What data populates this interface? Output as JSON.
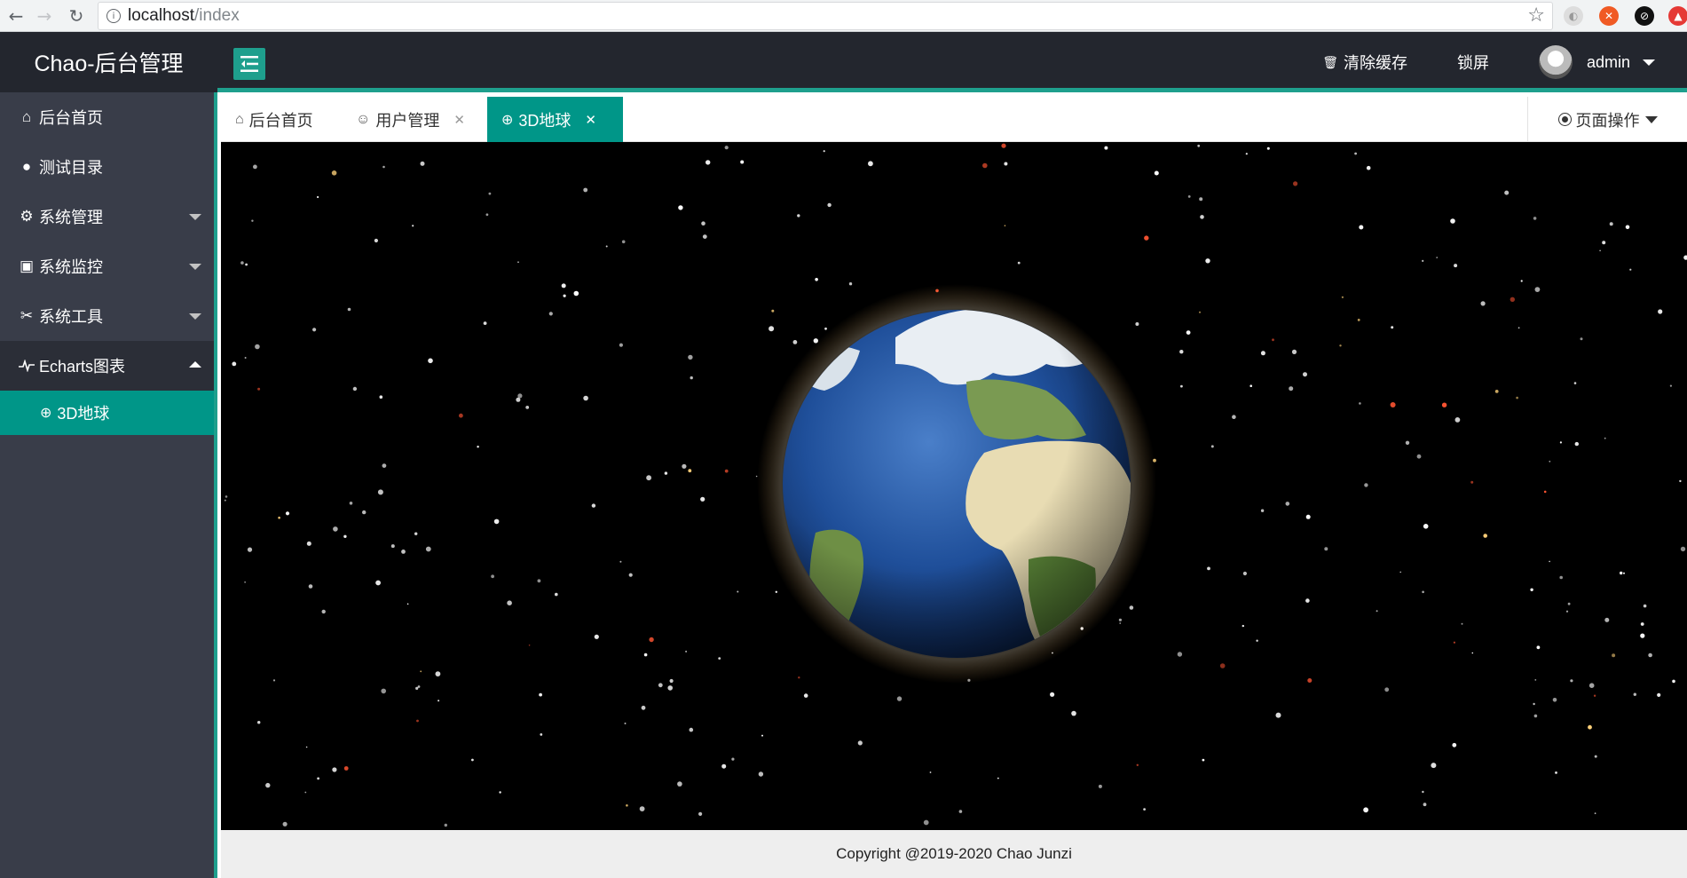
{
  "browser": {
    "back_icon": "arrow-left-icon",
    "forward_icon": "arrow-right-icon",
    "reload_icon": "reload-icon",
    "url_host": "localhost",
    "url_path": "/index",
    "bookmark_icon": "star-icon"
  },
  "header": {
    "app_title": "Chao-后台管理",
    "toggle_icon": "menu-fold-icon",
    "clear_cache": "清除缓存",
    "lock_screen": "锁屏",
    "user_name": "admin"
  },
  "sidebar": {
    "items": [
      {
        "label": "后台首页",
        "icon": "home-icon"
      },
      {
        "label": "测试目录",
        "icon": "circle-icon"
      },
      {
        "label": "系统管理",
        "icon": "gear-icon",
        "expanded": false
      },
      {
        "label": "系统监控",
        "icon": "monitor-icon",
        "expanded": false
      },
      {
        "label": "系统工具",
        "icon": "tools-icon",
        "expanded": false
      },
      {
        "label": "Echarts图表",
        "icon": "pulse-icon",
        "expanded": true
      }
    ],
    "submenu": [
      {
        "label": "3D地球",
        "icon": "globe-icon",
        "active": true
      }
    ]
  },
  "tabs": [
    {
      "label": "后台首页",
      "icon": "home-icon",
      "closable": false
    },
    {
      "label": "用户管理",
      "icon": "user-icon",
      "closable": true
    },
    {
      "label": "3D地球",
      "icon": "globe-icon",
      "closable": true,
      "active": true
    }
  ],
  "page_ops": {
    "label": "页面操作"
  },
  "footer": {
    "copyright": "Copyright @2019-2020 Chao Junzi"
  },
  "colors": {
    "accent": "#009688",
    "header_bg": "#23262e",
    "sidebar_bg": "#393d49"
  }
}
